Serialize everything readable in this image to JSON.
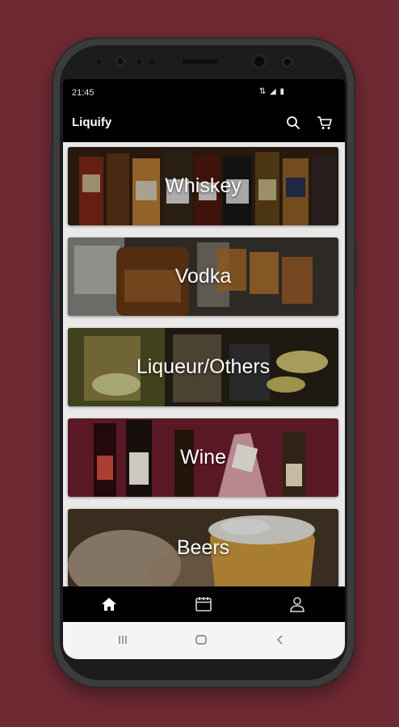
{
  "status_bar": {
    "time": "21:45",
    "icons": "⇅ ◢ ▮"
  },
  "app_bar": {
    "title": "Liquify",
    "search_icon": "search-icon",
    "cart_icon": "cart-icon"
  },
  "categories": [
    {
      "label": "Whiskey"
    },
    {
      "label": "Vodka"
    },
    {
      "label": "Liqueur/Others"
    },
    {
      "label": "Wine"
    },
    {
      "label": "Beers"
    }
  ],
  "bottom_nav": {
    "items": [
      {
        "icon": "home-icon",
        "active": true
      },
      {
        "icon": "calendar-icon",
        "active": false
      },
      {
        "icon": "account-icon",
        "active": false
      }
    ]
  },
  "system_nav": {
    "recent_icon": "recent-apps-icon",
    "home_icon": "home-button-icon",
    "back_icon": "back-icon"
  },
  "colors": {
    "background": "#6f2a33",
    "app_bar": "#000000",
    "wine_card": "#6a1d2c"
  }
}
